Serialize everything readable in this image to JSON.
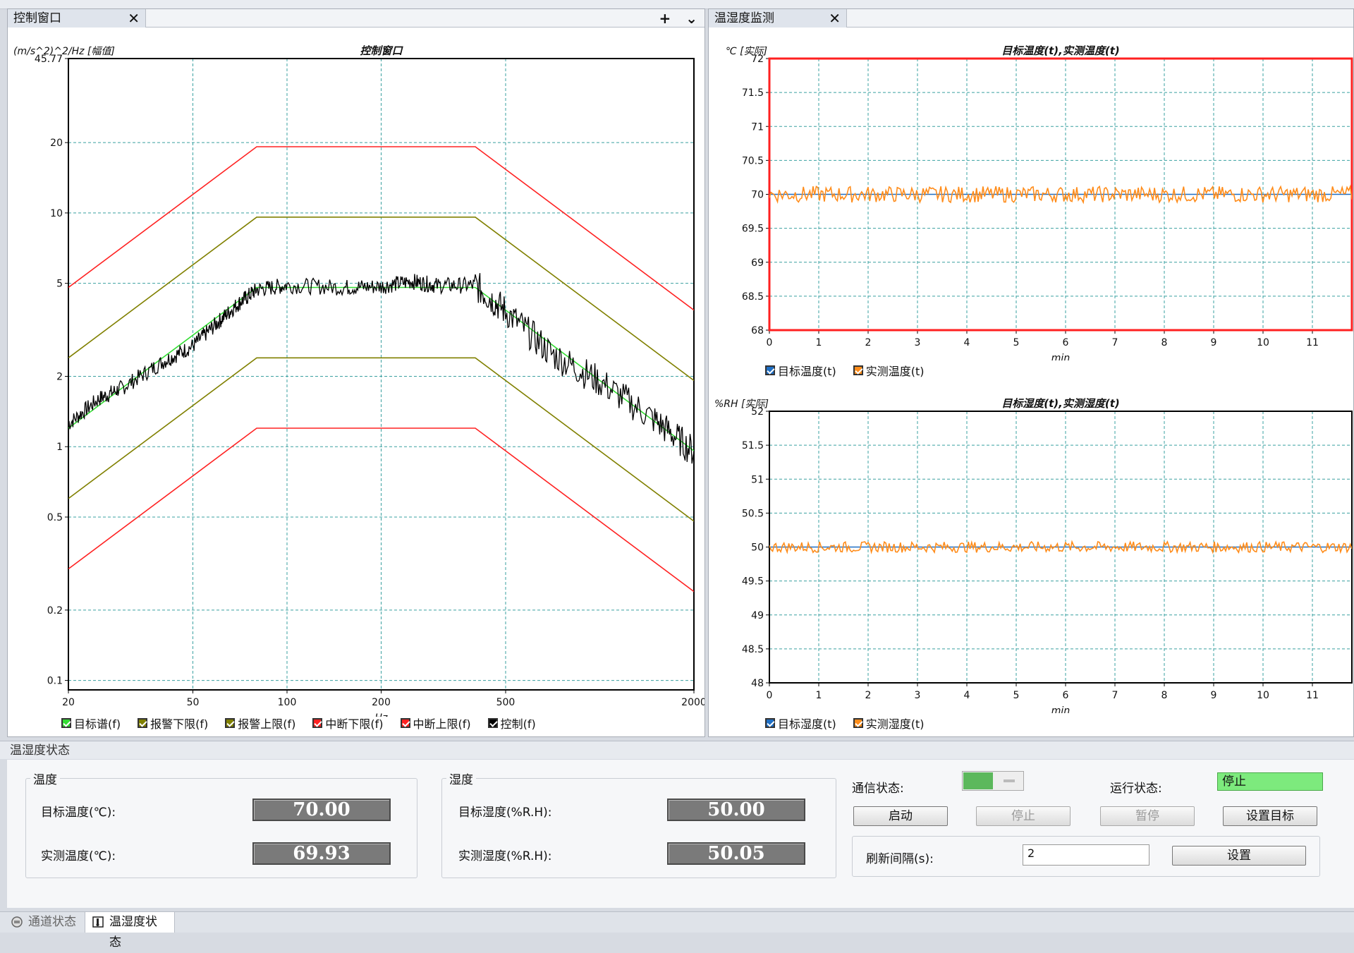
{
  "left_panel": {
    "tab_title": "控制窗口",
    "tab_close": "✕",
    "tab_add": "+",
    "tab_menu": "⌄"
  },
  "right_panel": {
    "tab_title": "温湿度监测",
    "tab_close": "✕"
  },
  "colors": {
    "target": "#33dd33",
    "alarm": "#808000",
    "abort": "#ff2222",
    "control": "#000000",
    "actual": "#ff8c1a",
    "target_blue": "#1f6fc5",
    "grid": "#3aa0a0",
    "comm_ok": "#5cb85c",
    "run_state_bg": "#7dea7d"
  },
  "chart_data": [
    {
      "type": "line",
      "title": "控制窗口",
      "ylabel": "(m/s^2)^2/Hz [幅值]",
      "xlabel": "Hz",
      "xscale": "log",
      "yscale": "log",
      "xlim": [
        20,
        2000
      ],
      "ylim": [
        0.0911,
        45.77
      ],
      "x_ticks": [
        "20",
        "50",
        "100",
        "200",
        "500",
        "2000"
      ],
      "y_ticks": [
        "0.1",
        "0.2",
        "0.5",
        "1",
        "2",
        "5",
        "10",
        "20",
        "45.77"
      ],
      "series": [
        {
          "name": "目标谱(f)",
          "x": [
            20,
            80,
            400,
            2000
          ],
          "y": [
            1.2,
            4.8,
            4.8,
            0.96
          ]
        },
        {
          "name": "报警下限(f)",
          "x": [
            20,
            80,
            400,
            2000
          ],
          "y": [
            0.6,
            2.4,
            2.4,
            0.48
          ]
        },
        {
          "name": "报警上限(f)",
          "x": [
            20,
            80,
            400,
            2000
          ],
          "y": [
            2.4,
            9.6,
            9.6,
            1.92
          ]
        },
        {
          "name": "中断下限(f)",
          "x": [
            20,
            80,
            400,
            2000
          ],
          "y": [
            0.3,
            1.2,
            1.2,
            0.24
          ]
        },
        {
          "name": "中断上限(f)",
          "x": [
            20,
            80,
            400,
            2000
          ],
          "y": [
            4.8,
            19.2,
            19.2,
            3.84
          ]
        },
        {
          "name": "控制(f)",
          "x": [
            20,
            25,
            30,
            40,
            50,
            60,
            70,
            80,
            100,
            150,
            200,
            250,
            300,
            400,
            500,
            700,
            1000,
            1500,
            2000
          ],
          "y": [
            1.25,
            1.6,
            1.8,
            2.3,
            2.7,
            3.4,
            4.1,
            4.7,
            4.9,
            4.8,
            4.85,
            5.1,
            4.9,
            4.9,
            3.8,
            2.5,
            1.9,
            1.3,
            0.95
          ]
        }
      ]
    },
    {
      "type": "line",
      "title": "目标温度(t),实测温度(t)",
      "ylabel": "℃ [实际]",
      "xlabel": "min",
      "xlim": [
        0,
        11.8
      ],
      "ylim": [
        68,
        72
      ],
      "x_ticks": [
        "0",
        "1",
        "2",
        "3",
        "4",
        "5",
        "6",
        "7",
        "8",
        "9",
        "10",
        "11"
      ],
      "y_ticks": [
        "68",
        "68.5",
        "69",
        "69.5",
        "70",
        "70.5",
        "71",
        "71.5",
        "72"
      ],
      "series": [
        {
          "name": "目标温度(t)",
          "x": [
            0,
            11.8
          ],
          "y": [
            70,
            70
          ]
        },
        {
          "name": "实测温度(t)",
          "x": [
            0,
            11.8
          ],
          "y": [
            70,
            70
          ],
          "noise": 0.12
        }
      ]
    },
    {
      "type": "line",
      "title": "目标湿度(t),实测湿度(t)",
      "ylabel": "%RH [实际]",
      "xlabel": "min",
      "xlim": [
        0,
        11.8
      ],
      "ylim": [
        48,
        52
      ],
      "x_ticks": [
        "0",
        "1",
        "2",
        "3",
        "4",
        "5",
        "6",
        "7",
        "8",
        "9",
        "10",
        "11"
      ],
      "y_ticks": [
        "48",
        "48.5",
        "49",
        "49.5",
        "50",
        "50.5",
        "51",
        "51.5",
        "52"
      ],
      "series": [
        {
          "name": "目标湿度(t)",
          "x": [
            0,
            11.8
          ],
          "y": [
            50,
            50
          ]
        },
        {
          "name": "实测湿度(t)",
          "x": [
            0,
            11.8
          ],
          "y": [
            50,
            50
          ],
          "noise": 0.08
        }
      ]
    }
  ],
  "status_panel": {
    "title": "温湿度状态",
    "temperature": {
      "group_title": "温度",
      "target_label": "目标温度(℃):",
      "target_value": "70.00",
      "actual_label": "实测温度(℃):",
      "actual_value": "69.93"
    },
    "humidity": {
      "group_title": "湿度",
      "target_label": "目标湿度(%R.H):",
      "target_value": "50.00",
      "actual_label": "实测湿度(%R.H):",
      "actual_value": "50.05"
    },
    "comm_label": "通信状态:",
    "run_label": "运行状态:",
    "run_value": "停止",
    "buttons": {
      "start": "启动",
      "stop": "停止",
      "pause": "暂停",
      "set_target": "设置目标"
    },
    "refresh_label": "刷新间隔(s):",
    "refresh_value": "2",
    "set_button": "设置"
  },
  "bottom_tabs": [
    "通道状态",
    "温湿度状态"
  ]
}
